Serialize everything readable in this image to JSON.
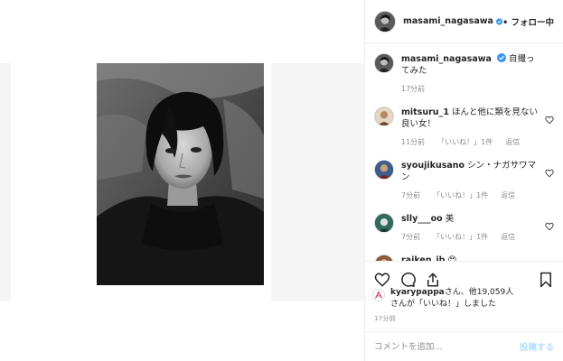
{
  "post_author": {
    "username": "masami_nagasawa",
    "follow_label": "• フォロー中",
    "avatar_icon": "profile-avatar"
  },
  "caption": {
    "username": "masami_nagasawa",
    "text": "自撮ってみた",
    "time": "17分前"
  },
  "comments": [
    {
      "username": "mitsuru_1",
      "text": "ほんと他に類を見ない良い女！",
      "time": "11分前",
      "likes": "「いいね！」1件",
      "reply": "返信"
    },
    {
      "username": "syoujikusano",
      "text": "シン・ナガサワマン",
      "time": "7分前",
      "likes": "「いいね！」1件",
      "reply": "返信"
    },
    {
      "username": "slly___oo",
      "text": "美",
      "time": "7分前",
      "likes": "「いいね！」1件",
      "reply": "返信"
    },
    {
      "username": "raiken_ib",
      "text": "😍"
    }
  ],
  "likes_summary": {
    "username": "kyarypappa",
    "line1_suffix": "さん、他19,059人",
    "line2": "さんが「いいね！」しました"
  },
  "post_time": "17分前",
  "comment_box": {
    "placeholder": "コメントを追加...",
    "post_label": "投稿する"
  },
  "colors": {
    "verified_blue": "#3897f0",
    "border": "#efefef",
    "muted_text": "#8e8e8e",
    "post_button_disabled": "#b2dffc"
  }
}
